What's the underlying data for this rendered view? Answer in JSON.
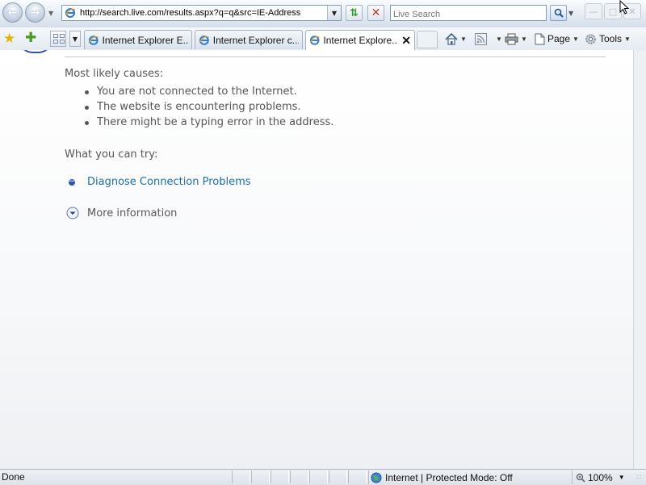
{
  "window": {
    "minimize_label": "—",
    "maximize_label": "□",
    "close_label": "✕"
  },
  "navbar": {
    "back_icon": "back-arrow-icon",
    "forward_icon": "forward-arrow-icon",
    "address_url": "http://search.live.com/results.aspx?q=q&src=IE-Address",
    "search_placeholder": "Live Search"
  },
  "tabs": [
    {
      "label": "Internet Explorer E...",
      "active": false
    },
    {
      "label": "Internet Explorer c...",
      "active": false
    },
    {
      "label": "Internet Explore...",
      "active": true
    }
  ],
  "commands": {
    "page_label": "Page",
    "tools_label": "Tools"
  },
  "content": {
    "causes_title": "Most likely causes:",
    "causes": [
      "You are not connected to the Internet.",
      "The website is encountering problems.",
      "There might be a typing error in the address."
    ],
    "try_title": "What you can try:",
    "diagnose_link": "Diagnose Connection Problems",
    "more_info": "More information"
  },
  "status": {
    "left_text": "Done",
    "zone_text": "Internet | Protected Mode: Off",
    "zoom_text": "100%"
  },
  "colors": {
    "link": "#1b6ea8",
    "body_text": "#575757"
  }
}
